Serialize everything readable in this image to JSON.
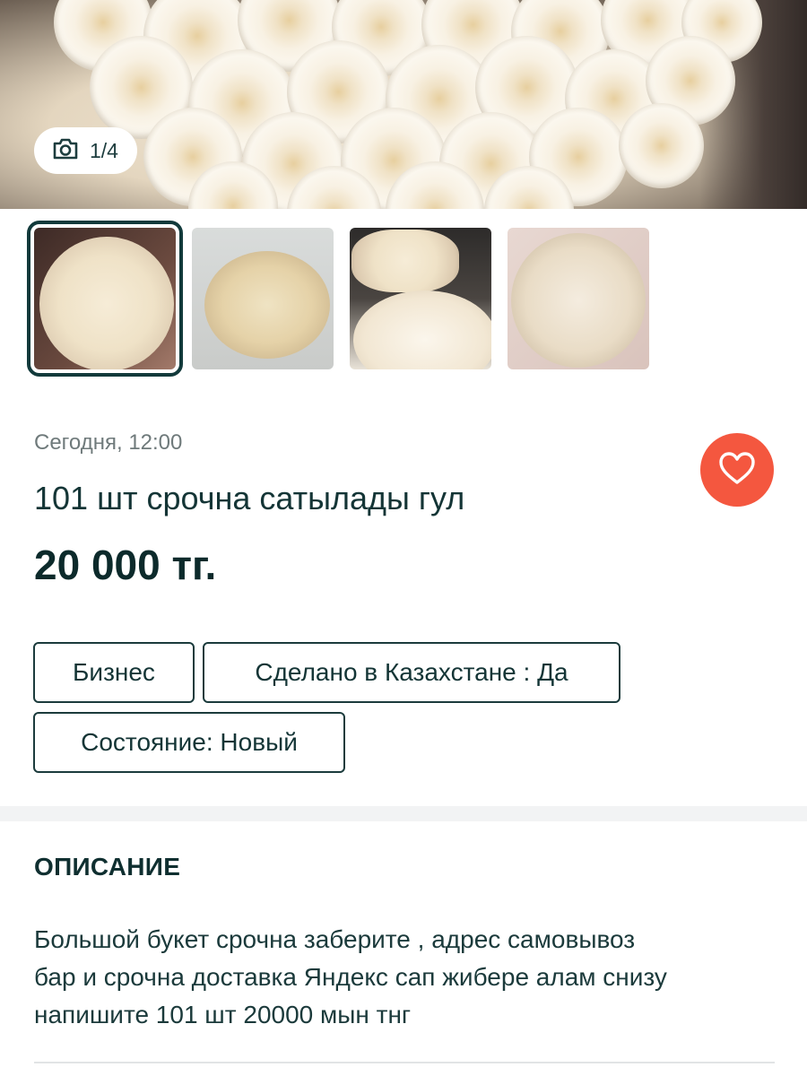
{
  "gallery": {
    "counter": "1/4",
    "icon": "camera-icon",
    "thumbnail_count": 4,
    "active_index": 0
  },
  "listing": {
    "date": "Сегодня, 12:00",
    "title": "101 шт срочна сатылады гул",
    "price": "20 000 тг.",
    "favorite_icon": "heart-icon"
  },
  "tags": [
    {
      "label": "Бизнес"
    },
    {
      "label": "Сделано в Казахстане : Да"
    },
    {
      "label": "Состояние: Новый"
    }
  ],
  "description": {
    "heading": "ОПИСАНИЕ",
    "lines": [
      "Большой букет срочна заберите , адрес самовывоз",
      "бар и срочна доставка Яндекс сап жибере алам снизу",
      "напишите 101 шт 20000 мын тнг"
    ]
  },
  "colors": {
    "accent": "#f4573f",
    "primary_text": "#0f2a2b",
    "muted_text": "#6f7a7b"
  }
}
